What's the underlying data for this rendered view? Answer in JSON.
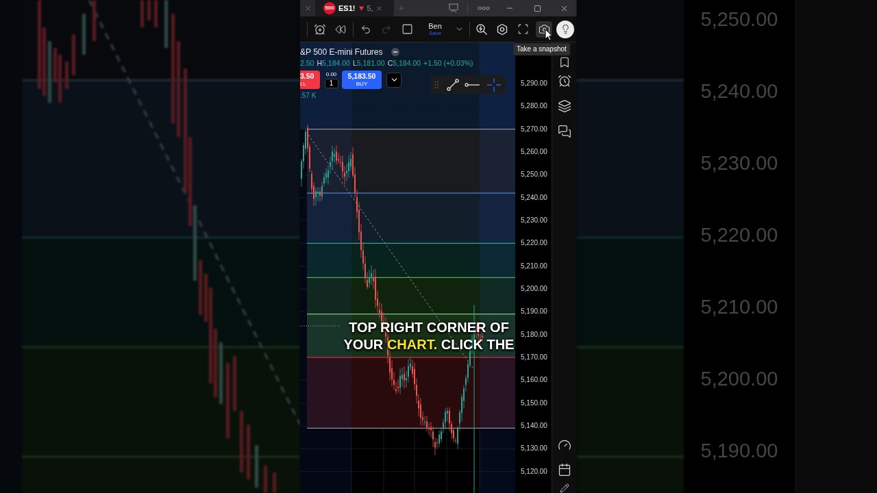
{
  "backdrop": {
    "price_labels": [
      "5,250.00",
      "5,240.00",
      "5,230.00",
      "5,220.00",
      "5,210.00",
      "5,200.00",
      "5,190.00"
    ]
  },
  "tabs": [
    {
      "selected": false
    },
    {
      "selected": true,
      "logo": "500",
      "symbol": "ES1!",
      "falling": true,
      "price": "5,"
    }
  ],
  "toolbar": {
    "redo": {
      "disabled": true
    },
    "layout": {
      "name": "Ben",
      "status": "Save"
    },
    "snapshot": {
      "hovered": true,
      "tooltip": "Take a snapshot"
    }
  },
  "legend": {
    "title": "&P 500 E-mini Futures",
    "ohlc": [
      {
        "value": "2.50"
      },
      {
        "label": "H",
        "value": "5,184.00"
      },
      {
        "label": "L",
        "value": "5,181.00"
      },
      {
        "label": "C",
        "value": "5,184.00"
      }
    ],
    "change": "+1.50 (+0.03%)",
    "volume": ".57 K"
  },
  "trade": {
    "sell": {
      "price": "3.50",
      "label": "LL"
    },
    "spread": "0.00",
    "quantity": "1",
    "buy": {
      "price": "5,183.50",
      "label": "BUY"
    }
  },
  "drawing_tools": [
    {
      "kind": "trend_line",
      "selected": false
    },
    {
      "kind": "horizontal_ray",
      "selected": false
    },
    {
      "kind": "crosshair",
      "selected": true
    }
  ],
  "price_axis": [
    "5,290.00",
    "5,280.00",
    "5,270.00",
    "5,260.00",
    "5,250.00",
    "5,240.00",
    "5,230.00",
    "5,220.00",
    "5,210.00",
    "5,200.00",
    "5,190.00",
    "5,180.00",
    "5,170.00",
    "5,160.00",
    "5,150.00",
    "5,140.00",
    "5,130.00",
    "5,120.00"
  ],
  "caption": {
    "lines": [
      [
        {
          "text": "TOP RIGHT CORNER OF",
          "highlight": false
        }
      ],
      [
        {
          "text": "YOUR",
          "highlight": false
        },
        {
          "text": "CHART.",
          "highlight": true
        },
        {
          "text": "CLICK THE",
          "highlight": false
        }
      ]
    ]
  }
}
